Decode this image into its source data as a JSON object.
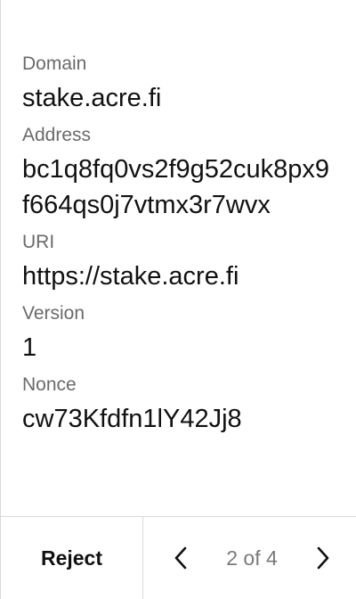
{
  "fields": [
    {
      "label": "Domain",
      "value": "stake.acre.fi"
    },
    {
      "label": "Address",
      "value": "bc1q8fq0vs2f9g52cuk8px9f664qs0j7vtmx3r7wvx"
    },
    {
      "label": "URI",
      "value": "https://stake.acre.fi"
    },
    {
      "label": "Version",
      "value": "1"
    },
    {
      "label": "Nonce",
      "value": "cw73Kfdfn1lY42Jj8"
    }
  ],
  "footer": {
    "reject_label": "Reject",
    "page_indicator": "2 of 4",
    "prev_icon": "chevron-left-icon",
    "next_icon": "chevron-right-icon"
  },
  "colors": {
    "label": "#6a6a6a",
    "value": "#111111",
    "divider": "#d9d9d9",
    "muted": "#7a7a7a"
  }
}
